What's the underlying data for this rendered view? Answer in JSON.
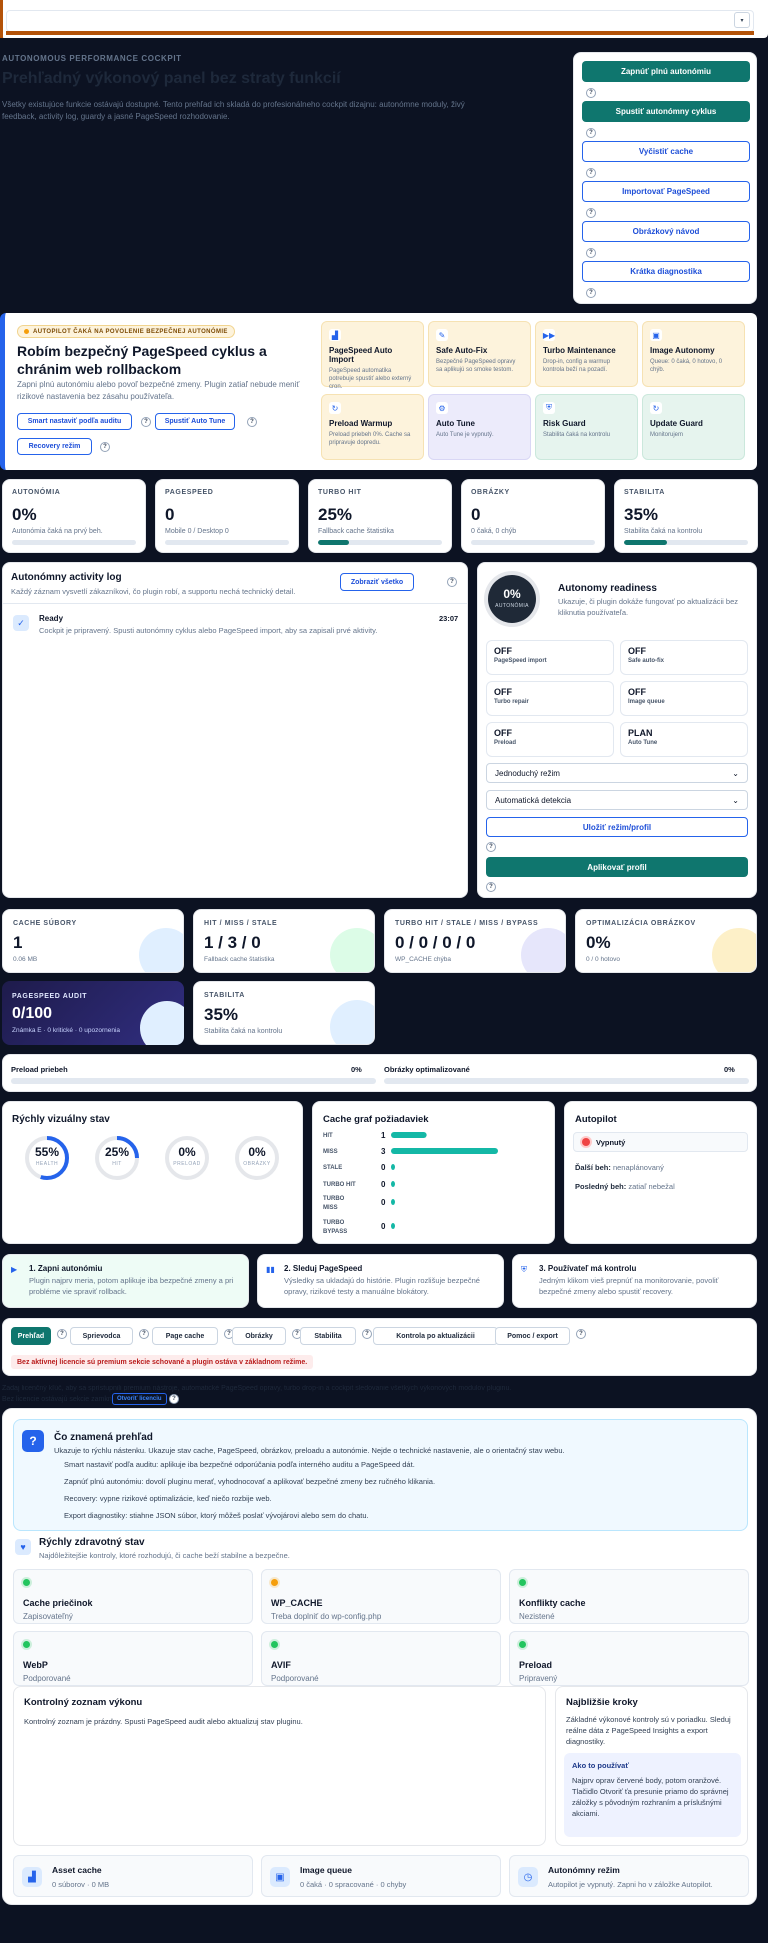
{
  "cockpit": {
    "kicker": "AUTONOMOUS PERFORMANCE COCKPIT",
    "title": "Prehľadný výkonový panel bez straty funkcií",
    "subtitle": "Všetky existujúce funkcie ostávajú dostupné. Tento prehľad ich skladá do profesionálneho cockpit dizajnu: autonómne moduly, živý feedback, activity log, guardy a jasné PageSpeed rozhodovanie."
  },
  "actions": [
    {
      "label": "Zapnúť plnú autonómiu",
      "style": "green"
    },
    {
      "label": "Spustiť autonómny cyklus",
      "style": "green"
    },
    {
      "label": "Vyčistiť cache",
      "style": "outline"
    },
    {
      "label": "Importovať PageSpeed",
      "style": "outline"
    },
    {
      "label": "Obrázkový návod",
      "style": "outline"
    },
    {
      "label": "Krátka diagnostika",
      "style": "outline"
    }
  ],
  "hero": {
    "badge": "AUTOPILOT ČAKÁ NA POVOLENIE BEZPEČNEJ AUTONÓMIE",
    "title": "Robím bezpečný PageSpeed cyklus a chránim web rollbackom",
    "text": "Zapni plnú autonómiu alebo povoľ bezpečné zmeny. Plugin zatiaľ nebude meniť rizikové nastavenia bez zásahu používateľa.",
    "btn_smart": "Smart nastaviť podľa auditu",
    "btn_tune": "Spustiť Auto Tune",
    "btn_recovery": "Recovery režim"
  },
  "modules": [
    {
      "title": "PageSpeed Auto Import",
      "desc": "PageSpeed automatika potrebuje spustiť alebo externý cron.",
      "icon": "chart-icon",
      "glyph": "▟",
      "bg": "#fdf3dc",
      "border": "#f6e2b3",
      "icolor": "#2563eb"
    },
    {
      "title": "Safe Auto-Fix",
      "desc": "Bezpečné PageSpeed opravy sa aplikujú so smoke testom.",
      "icon": "wrench-icon",
      "glyph": "✎",
      "bg": "#fdf3dc",
      "border": "#f6e2b3",
      "icolor": "#2563eb"
    },
    {
      "title": "Turbo Maintenance",
      "desc": "Drop-in, config a warmup kontrola beží na pozadí.",
      "icon": "fast-forward-icon",
      "glyph": "▶▶",
      "bg": "#fdf3dc",
      "border": "#f6e2b3",
      "icolor": "#2563eb"
    },
    {
      "title": "Image Autonomy",
      "desc": "Queue: 0 čaká, 0 hotovo, 0 chýb.",
      "icon": "image-icon",
      "glyph": "▣",
      "bg": "#fdf3dc",
      "border": "#f6e2b3",
      "icolor": "#2563eb"
    },
    {
      "title": "Preload Warmup",
      "desc": "Preload priebeh 0%. Cache sa pripravuje dopredu.",
      "icon": "refresh-icon",
      "glyph": "↻",
      "bg": "#fdf3dc",
      "border": "#f6e2b3",
      "icolor": "#2563eb"
    },
    {
      "title": "Auto Tune",
      "desc": "Auto Tune je vypnutý.",
      "icon": "gear-icon",
      "glyph": "⚙",
      "bg": "#ecebfb",
      "border": "#d9d7f5",
      "icolor": "#2563eb"
    },
    {
      "title": "Risk Guard",
      "desc": "Stabilita čaká na kontrolu",
      "icon": "shield-icon",
      "glyph": "⛨",
      "bg": "#e6f4ee",
      "border": "#cbe8dc",
      "icolor": "#2563eb"
    },
    {
      "title": "Update Guard",
      "desc": "Monitorujem",
      "icon": "refresh-icon",
      "glyph": "↻",
      "bg": "#e6f4ee",
      "border": "#cbe8dc",
      "icolor": "#2563eb"
    }
  ],
  "kpis": [
    {
      "label": "AUTONÓMIA",
      "value": "0%",
      "sub": "Autonómia čaká na prvý beh.",
      "pct": 0
    },
    {
      "label": "PAGESPEED",
      "value": "0",
      "sub": "Mobile 0 / Desktop 0",
      "pct": 0
    },
    {
      "label": "TURBO HIT",
      "value": "25%",
      "sub": "Fallback cache štatistika",
      "pct": 25
    },
    {
      "label": "OBRÁZKY",
      "value": "0",
      "sub": "0 čaká, 0 chýb",
      "pct": 0
    },
    {
      "label": "STABILITA",
      "value": "35%",
      "sub": "Stabilita čaká na kontrolu",
      "pct": 35
    }
  ],
  "activity": {
    "title": "Autonómny activity log",
    "subtitle": "Každý záznam vysvetlí zákazníkovi, čo plugin robí, a supportu nechá technický detail.",
    "show_all": "Zobraziť všetko",
    "entry_title": "Ready",
    "entry_text": "Cockpit je pripravený. Spusti autonómny cyklus alebo PageSpeed import, aby sa zapisali prvé aktivity.",
    "entry_time": "23:07"
  },
  "readiness": {
    "value": "0%",
    "value_label": "AUTONÓMIA",
    "title": "Autonomy readiness",
    "subtitle": "Ukazuje, či plugin dokáže fungovať po aktualizácii bez kliknutia používateľa.",
    "items": [
      {
        "value": "OFF",
        "label": "PageSpeed import"
      },
      {
        "value": "OFF",
        "label": "Safe auto-fix"
      },
      {
        "value": "OFF",
        "label": "Turbo repair"
      },
      {
        "value": "OFF",
        "label": "Image queue"
      },
      {
        "value": "OFF",
        "label": "Preload"
      },
      {
        "value": "PLAN",
        "label": "Auto Tune"
      }
    ],
    "mode_select": "Jednoduchý režim",
    "detect_select": "Automatická detekcia",
    "save_btn": "Uložiť režim/profil",
    "apply_btn": "Aplikovať profil"
  },
  "stats": [
    {
      "label": "CACHE SÚBORY",
      "value": "1",
      "sub": "0.06 MB",
      "blob": "#e0efff"
    },
    {
      "label": "HIT / MISS / STALE",
      "value": "1 / 3 / 0",
      "sub": "Fallback cache štatistika",
      "blob": "#dcfce7"
    },
    {
      "label": "TURBO HIT / STALE / MISS / BYPASS",
      "value": "0 / 0 / 0 / 0",
      "sub": "WP_CACHE chýba",
      "blob": "#e6e6fb"
    },
    {
      "label": "OPTIMALIZÁCIA OBRÁZKOV",
      "value": "0%",
      "sub": "0 / 0 hotovo",
      "blob": "#fdf0c8"
    }
  ],
  "audit": {
    "label": "PAGESPEED AUDIT",
    "value": "0/100",
    "sub": "Známka E · 0 kritické · 0 upozornenia"
  },
  "stability": {
    "label": "STABILITA",
    "value": "35%",
    "sub": "Stabilita čaká na kontrolu"
  },
  "progress": [
    {
      "label": "Preload priebeh",
      "value": "0%",
      "pct": 0
    },
    {
      "label": "Obrázky optimalizované",
      "value": "0%",
      "pct": 0
    }
  ],
  "visual": {
    "title": "Rýchly vizuálny stav",
    "rings": [
      {
        "value": "55%",
        "label": "HEALTH",
        "pct": 55
      },
      {
        "value": "25%",
        "label": "HIT",
        "pct": 25
      },
      {
        "value": "0%",
        "label": "PRELOAD",
        "pct": 0
      },
      {
        "value": "0%",
        "label": "OBRÁZKY",
        "pct": 0
      }
    ]
  },
  "cache_chart": {
    "title": "Cache graf požiadaviek",
    "rows": [
      {
        "label": "HIT",
        "value": 1
      },
      {
        "label": "MISS",
        "value": 3
      },
      {
        "label": "STALE",
        "value": 0
      },
      {
        "label": "TURBO HIT",
        "value": 0
      },
      {
        "label": "TURBO MISS",
        "value": 0
      },
      {
        "label": "TURBO BYPASS",
        "value": 0
      }
    ]
  },
  "chart_data": {
    "type": "bar",
    "title": "Cache graf požiadaviek",
    "categories": [
      "HIT",
      "MISS",
      "STALE",
      "TURBO HIT",
      "TURBO MISS",
      "TURBO BYPASS"
    ],
    "values": [
      1,
      3,
      0,
      0,
      0,
      0
    ]
  },
  "autopilot": {
    "title": "Autopilot",
    "status": "Vypnutý",
    "next_label": "Ďalší beh:",
    "next_value": "nenaplánovaný",
    "last_label": "Posledný beh:",
    "last_value": "zatiaľ nebežal"
  },
  "steps": [
    {
      "title": "1. Zapni autonómiu",
      "text": "Plugin najprv meria, potom aplikuje iba bezpečné zmeny a pri probléme vie spraviť rollback."
    },
    {
      "title": "2. Sleduj PageSpeed",
      "text": "Výsledky sa ukladajú do histórie. Plugin rozlišuje bezpečné opravy, rizikové testy a manuálne blokátory."
    },
    {
      "title": "3. Používateľ má kontrolu",
      "text": "Jedným klikom vieš prepnúť na monitorovanie, povoliť bezpečné zmeny alebo spustiť recovery."
    }
  ],
  "tabs": [
    "Prehľad",
    "Sprievodca",
    "Page cache",
    "Obrázky",
    "Stabilita",
    "Kontrola po aktualizácii",
    "Pomoc / export"
  ],
  "license_warning": "Bez aktívnej licencie sú premium sekcie schované a plugin ostáva v základnom režime.",
  "license": {
    "hidden_line": "Zadaj licenčný kľúč, aby sa sprístupnili premium nástroje, automatické PageSpeed opravy, turbo drop-in a cockpit sledovanie všetkých výkonových modulov pluginu.",
    "hidden_line2": "Bez licencie ostávajú sekcie zamknuté a",
    "open_label": "Otvoriť licenciu"
  },
  "overview": {
    "title": "Čo znamená prehľad",
    "text": "Ukazuje to rýchlu nástenku. Ukazuje stav cache, PageSpeed, obrázkov, preloadu a autonómie. Nejde o technické nastavenie, ale o orientačný stav webu.",
    "items": [
      "Smart nastaviť podľa auditu: aplikuje iba bezpečné odporúčania podľa interného auditu a PageSpeed dát.",
      "Zapnúť plnú autonómiu: dovolí pluginu merať, vyhodnocovať a aplikovať bezpečné zmeny bez ručného klikania.",
      "Recovery: vypne rizikové optimalizácie, keď niečo rozbije web.",
      "Export diagnostiky: stiahne JSON súbor, ktorý môžeš poslať vývojárovi alebo sem do chatu."
    ]
  },
  "health": {
    "title": "Rýchly zdravotný stav",
    "subtitle": "Najdôležitejšie kontroly, ktoré rozhodujú, či cache beží stabilne a bezpečne.",
    "items": [
      {
        "name": "Cache priečinok",
        "status": "Zapisovateľný",
        "color": "#22c55e"
      },
      {
        "name": "WP_CACHE",
        "status": "Treba doplniť do wp-config.php",
        "color": "#f59e0b"
      },
      {
        "name": "Konflikty cache",
        "status": "Nezistené",
        "color": "#22c55e"
      },
      {
        "name": "WebP",
        "status": "Podporované",
        "color": "#22c55e"
      },
      {
        "name": "AVIF",
        "status": "Podporované",
        "color": "#22c55e"
      },
      {
        "name": "Preload",
        "status": "Pripravený",
        "color": "#22c55e"
      }
    ]
  },
  "checklist": {
    "title": "Kontrolný zoznam výkonu",
    "text": "Kontrolný zoznam je prázdny. Spusti PageSpeed audit alebo aktualizuj stav pluginu."
  },
  "next_steps": {
    "title": "Najbližšie kroky",
    "text": "Základné výkonové kontroly sú v poriadku. Sleduj reálne dáta z PageSpeed Insights a export diagnostiky.",
    "how_title": "Ako to používať",
    "how_text": "Najprv oprav červené body, potom oranžové. Tlačidlo Otvoriť ťa presunie priamo do správnej záložky s pôvodným rozhraním a príslušnými akciami."
  },
  "bottom": [
    {
      "title": "Asset cache",
      "text": "0 súborov · 0 MB",
      "icon": "chart-icon",
      "glyph": "▟"
    },
    {
      "title": "Image queue",
      "text": "0 čaká · 0 spracované · 0 chyby",
      "icon": "image-icon",
      "glyph": "▣"
    },
    {
      "title": "Autonómny režim",
      "text": "Autopilot je vypnutý. Zapni ho v záložke Autopilot.",
      "icon": "clock-icon",
      "glyph": "◷"
    }
  ],
  "colors": {
    "accent": "#0f766e",
    "link": "#2563eb",
    "background": "#0c1222",
    "ring": "#2563eb",
    "hero_bar": "#2563eb"
  }
}
